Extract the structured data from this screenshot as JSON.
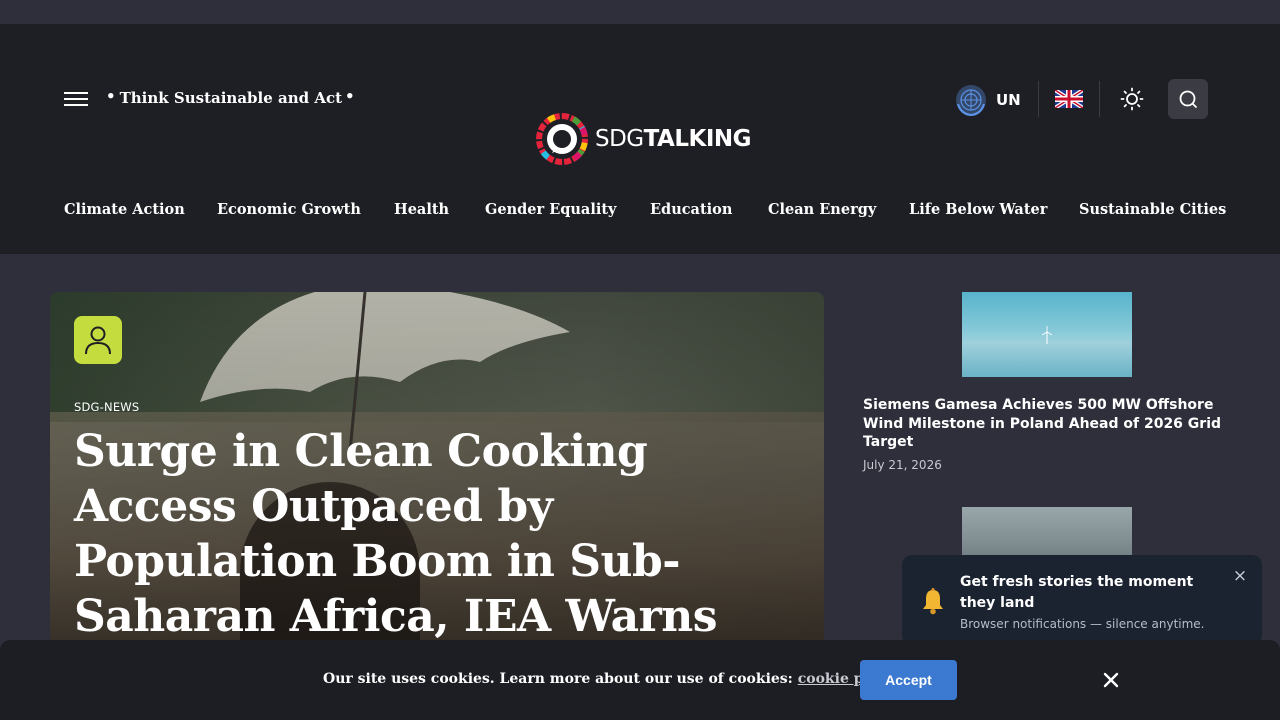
{
  "header": {
    "tagline": "Think Sustainable and Act",
    "logo": {
      "text_light": "SDG",
      "text_bold": "TALKING"
    },
    "un_label": "UN",
    "icons": {
      "menu": "hamburger-menu-icon",
      "un": "un-emblem-icon",
      "flag": "uk-flag-icon",
      "theme": "sun-icon",
      "search": "search-icon"
    }
  },
  "nav": {
    "items": [
      "Climate Action",
      "Economic Growth",
      "Health",
      "Gender Equality",
      "Education",
      "Clean Energy",
      "Life Below Water",
      "Sustainable Cities"
    ]
  },
  "hero": {
    "category": "SDG-NEWS",
    "title": "Surge in Clean Cooking Access Outpaced by Population Boom in Sub-Saharan Africa, IEA Warns",
    "author_icon": "user-icon"
  },
  "sidebar": {
    "articles": [
      {
        "title": "Siemens Gamesa Achieves 500 MW Offshore Wind Milestone in Poland Ahead of 2026 Grid Target",
        "date": "July 21, 2026"
      }
    ]
  },
  "notification": {
    "title": "Get fresh stories the moment they land",
    "subtitle": "Browser notifications — silence anytime.",
    "close": "×",
    "icon": "bell-icon"
  },
  "cookie": {
    "text": "Our site uses cookies. Learn more about our use of cookies:",
    "link": "cookie policy",
    "accept": "Accept",
    "close_icon": "close-icon"
  },
  "colors": {
    "header_bg": "#1e1f25",
    "page_bg": "#2e2f3b",
    "accent_button": "#3b7ad0",
    "author_badge": "#c5dc3e"
  }
}
